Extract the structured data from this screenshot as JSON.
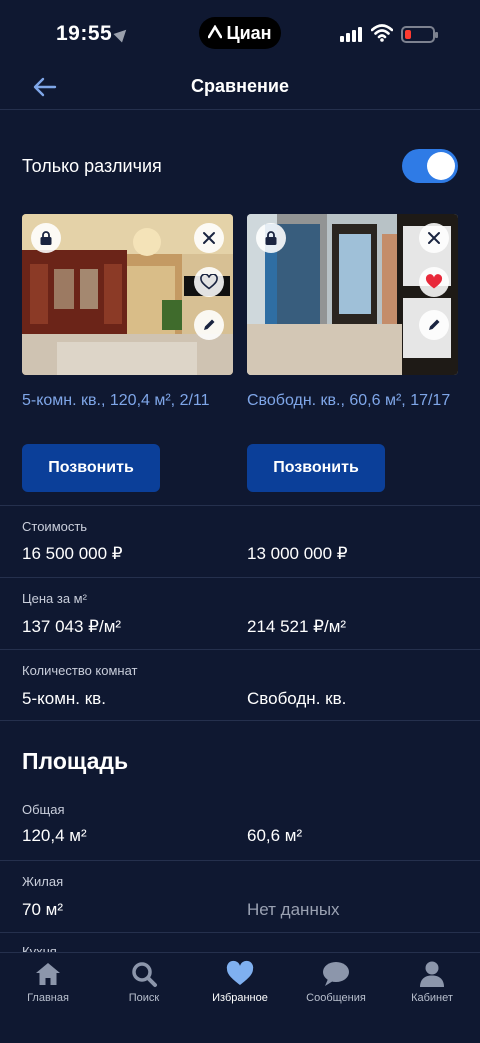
{
  "status_bar": {
    "time": "19:55",
    "app_name": "Циан"
  },
  "header": {
    "title": "Сравнение",
    "back_icon": "arrow-left-icon"
  },
  "filter": {
    "label": "Только различия",
    "enabled": true,
    "accent": "#2f7be6"
  },
  "listings": [
    {
      "title": "5-комн. кв., 120,4 м², 2/11",
      "call_label": "Позвонить",
      "favorite": false
    },
    {
      "title": "Свободн. кв., 60,6 м², 17/17",
      "call_label": "Позвонить",
      "favorite": true
    }
  ],
  "params": [
    {
      "label": "Стоимость",
      "left": "16 500 000 ₽",
      "right": "13 000 000 ₽"
    },
    {
      "label": "Цена за м²",
      "left": "137 043 ₽/м²",
      "right": "214 521 ₽/м²"
    },
    {
      "label": "Количество комнат",
      "left": "5-комн. кв.",
      "right": "Свободн. кв."
    }
  ],
  "area_section": {
    "title": "Площадь",
    "rows": [
      {
        "label": "Общая",
        "left": "120,4 м²",
        "right": "60,6 м²"
      },
      {
        "label": "Жилая",
        "left": "70 м²",
        "right": "Нет данных"
      }
    ],
    "next_label": "Кухня"
  },
  "nav": [
    {
      "label": "Главная",
      "icon": "home-icon"
    },
    {
      "label": "Поиск",
      "icon": "search-icon"
    },
    {
      "label": "Избранное",
      "icon": "heart-icon"
    },
    {
      "label": "Сообщения",
      "icon": "chat-icon"
    },
    {
      "label": "Кабинет",
      "icon": "person-icon"
    }
  ],
  "colors": {
    "background": "#0f1831",
    "button": "#0b3f99",
    "link": "#7fa6e8",
    "favorite": "#e8293a",
    "nav_active": "#7fb0f0",
    "nav_inactive": "#8c96ab"
  }
}
